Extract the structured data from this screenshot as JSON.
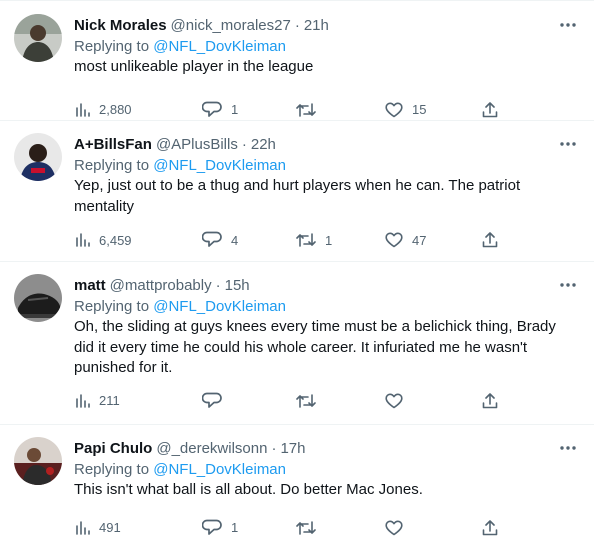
{
  "reply_prefix": "Replying to",
  "tweets": [
    {
      "name": "Nick Morales",
      "handle": "@nick_morales27",
      "separator": "·",
      "time": "21h",
      "mention": "@NFL_DovKleiman",
      "text": "most unlikeable player in the league",
      "views": "2,880",
      "replies": "1",
      "retweets": "",
      "likes": "15"
    },
    {
      "name": "A+BillsFan",
      "handle": "@APlusBills",
      "separator": "·",
      "time": "22h",
      "mention": "@NFL_DovKleiman",
      "text": "Yep, just out to be a thug and hurt players when he can. The patriot mentality",
      "views": "6,459",
      "replies": "4",
      "retweets": "1",
      "likes": "47"
    },
    {
      "name": "matt",
      "handle": "@mattprobably",
      "separator": "·",
      "time": "15h",
      "mention": "@NFL_DovKleiman",
      "text": "Oh, the sliding at guys knees every time must be a belichick thing, Brady did it every time he could his whole career. It infuriated me he wasn't punished for it.",
      "views": "211",
      "replies": "",
      "retweets": "",
      "likes": ""
    },
    {
      "name": "Papi Chulo",
      "handle": "@_derekwilsonn",
      "separator": "·",
      "time": "17h",
      "mention": "@NFL_DovKleiman",
      "text": "This isn't what ball is all about. Do better Mac Jones.",
      "views": "491",
      "replies": "1",
      "retweets": "",
      "likes": ""
    }
  ],
  "icons": {
    "views": "views-icon",
    "reply": "reply-icon",
    "retweet": "retweet-icon",
    "like": "like-icon",
    "share": "share-icon",
    "more": "more-icon"
  },
  "colors": {
    "text": "#0f1419",
    "secondary": "#536471",
    "link": "#1d9bf0",
    "divider": "#eff3f4"
  }
}
